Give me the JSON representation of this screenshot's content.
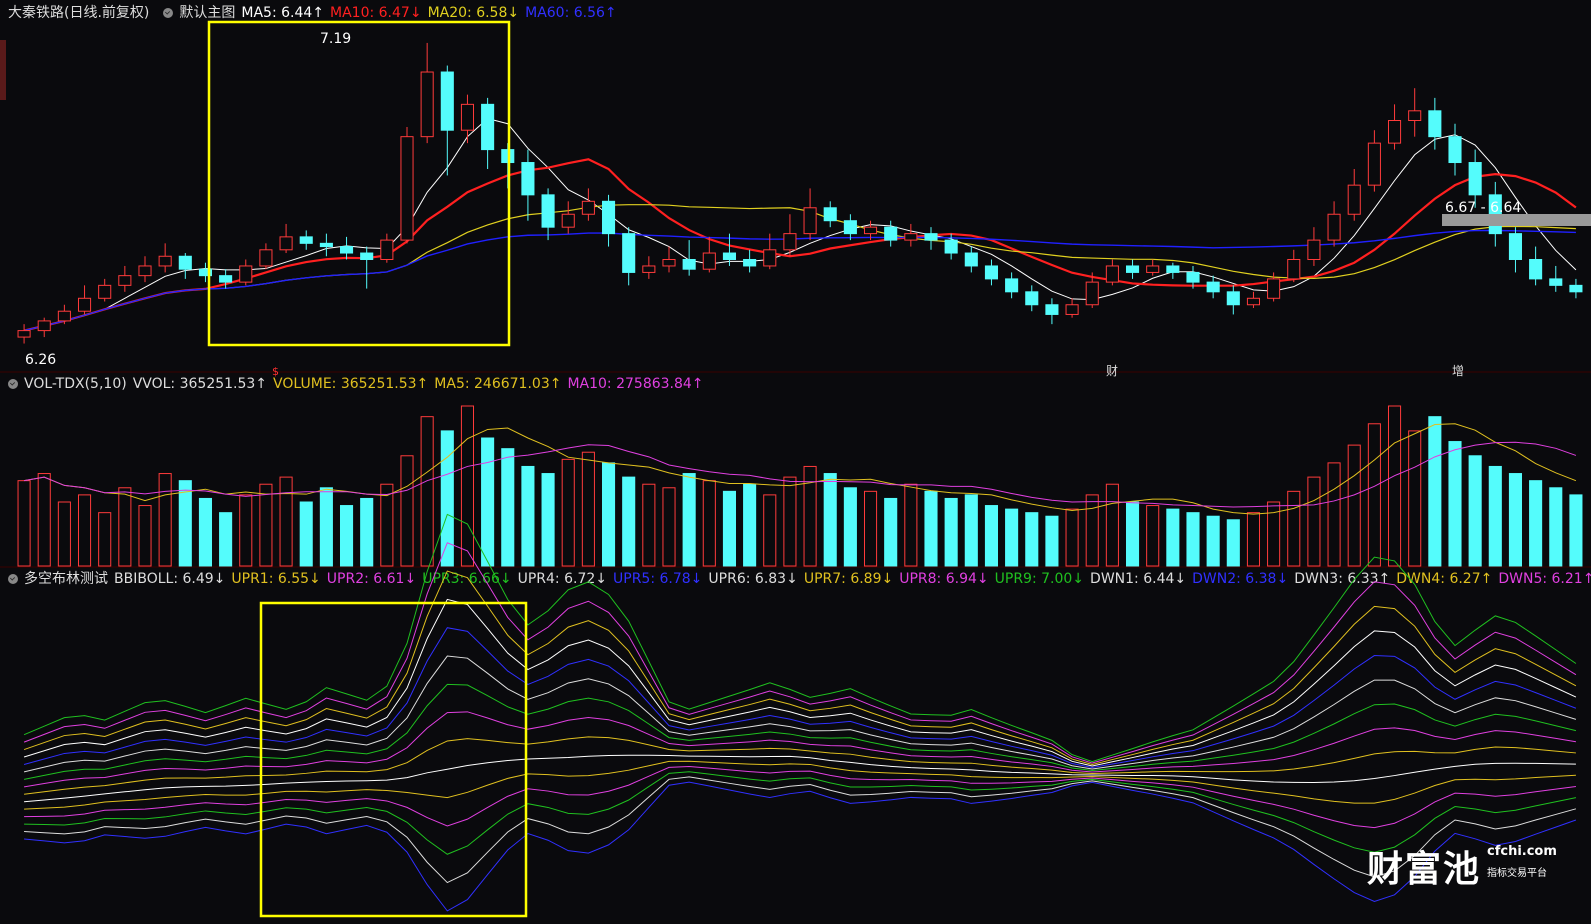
{
  "main_header": {
    "stock": "大秦铁路(日线.前复权)",
    "template": "默认主图",
    "ma5": "MA5: 6.44↑",
    "ma10": "MA10: 6.47↓",
    "ma20": "MA20: 6.58↓",
    "ma60": "MA60: 6.56↑"
  },
  "vol_header": {
    "name": "VOL-TDX(5,10)",
    "vvol": "VVOL: 365251.53↑",
    "volume": "VOLUME: 365251.53↑",
    "ma5": "MA5: 246671.03↑",
    "ma10": "MA10: 275863.84↑"
  },
  "boll_header": {
    "name": "多空布林测试",
    "bbiboll": "BBIBOLL: 6.49↓",
    "upr1": "UPR1: 6.55↓",
    "upr2": "UPR2: 6.61↓",
    "upr3": "UPR3: 6.66↓",
    "upr4": "UPR4: 6.72↓",
    "upr5": "UPR5: 6.78↓",
    "upr6": "UPR6: 6.83↓",
    "upr7": "UPR7: 6.89↓",
    "upr8": "UPR8: 6.94↓",
    "upr9": "UPR9: 7.00↓",
    "dwn1": "DWN1: 6.44↓",
    "dwn2": "DWN2: 6.38↓",
    "dwn3": "DWN3: 6.33↑",
    "dwn4": "DWN4: 6.27↑",
    "dwn5": "DWN5: 6.21↑"
  },
  "annotations": {
    "high_label": "7.19",
    "low_label": "6.26",
    "cursor_label": "6.67 - 6.64",
    "marker_s": "$",
    "marker_cai": "财",
    "marker_zeng": "增"
  },
  "watermark": {
    "brand": "财富池",
    "site": "cfchi.com",
    "tagline": "指标交易平台"
  },
  "colors": {
    "up": "#ff3b3b",
    "down": "#54fcfc",
    "ma5": "#ffffff",
    "ma10": "#ff2020",
    "ma20": "#e0d020",
    "ma60": "#2020ff",
    "highlight_box": "#ffff00"
  },
  "chart_data": [
    {
      "type": "candlestick",
      "title": "大秦铁路(日线.前复权)",
      "ylim": [
        6.26,
        7.19
      ],
      "candles": [
        [
          6.28,
          6.3,
          6.26,
          6.32
        ],
        [
          6.3,
          6.33,
          6.28,
          6.34
        ],
        [
          6.33,
          6.36,
          6.32,
          6.38
        ],
        [
          6.36,
          6.4,
          6.35,
          6.44
        ],
        [
          6.4,
          6.44,
          6.39,
          6.46
        ],
        [
          6.44,
          6.47,
          6.42,
          6.5
        ],
        [
          6.47,
          6.5,
          6.45,
          6.53
        ],
        [
          6.5,
          6.53,
          6.48,
          6.57
        ],
        [
          6.53,
          6.49,
          6.46,
          6.54
        ],
        [
          6.49,
          6.47,
          6.45,
          6.51
        ],
        [
          6.47,
          6.45,
          6.43,
          6.49
        ],
        [
          6.45,
          6.5,
          6.44,
          6.52
        ],
        [
          6.5,
          6.55,
          6.49,
          6.57
        ],
        [
          6.55,
          6.59,
          6.54,
          6.63
        ],
        [
          6.59,
          6.57,
          6.55,
          6.61
        ],
        [
          6.57,
          6.56,
          6.53,
          6.6
        ],
        [
          6.56,
          6.54,
          6.52,
          6.59
        ],
        [
          6.54,
          6.52,
          6.43,
          6.56
        ],
        [
          6.52,
          6.58,
          6.51,
          6.6
        ],
        [
          6.58,
          6.9,
          6.57,
          6.93
        ],
        [
          6.9,
          7.1,
          6.88,
          7.19
        ],
        [
          7.1,
          6.92,
          6.78,
          7.12
        ],
        [
          6.92,
          7.0,
          6.88,
          7.03
        ],
        [
          7.0,
          6.86,
          6.8,
          7.02
        ],
        [
          6.86,
          6.82,
          6.74,
          6.88
        ],
        [
          6.82,
          6.72,
          6.64,
          6.86
        ],
        [
          6.72,
          6.62,
          6.58,
          6.74
        ],
        [
          6.62,
          6.66,
          6.6,
          6.7
        ],
        [
          6.66,
          6.7,
          6.64,
          6.74
        ],
        [
          6.7,
          6.6,
          6.56,
          6.72
        ],
        [
          6.6,
          6.48,
          6.44,
          6.62
        ],
        [
          6.48,
          6.5,
          6.46,
          6.53
        ],
        [
          6.5,
          6.52,
          6.48,
          6.56
        ],
        [
          6.52,
          6.49,
          6.47,
          6.58
        ],
        [
          6.49,
          6.54,
          6.48,
          6.59
        ],
        [
          6.54,
          6.52,
          6.5,
          6.6
        ],
        [
          6.52,
          6.5,
          6.48,
          6.55
        ],
        [
          6.5,
          6.55,
          6.49,
          6.6
        ],
        [
          6.55,
          6.6,
          6.53,
          6.66
        ],
        [
          6.6,
          6.68,
          6.58,
          6.74
        ],
        [
          6.68,
          6.64,
          6.62,
          6.7
        ],
        [
          6.64,
          6.6,
          6.58,
          6.66
        ],
        [
          6.6,
          6.62,
          6.58,
          6.64
        ],
        [
          6.62,
          6.58,
          6.56,
          6.64
        ],
        [
          6.58,
          6.6,
          6.56,
          6.63
        ],
        [
          6.6,
          6.58,
          6.55,
          6.62
        ],
        [
          6.58,
          6.54,
          6.52,
          6.6
        ],
        [
          6.54,
          6.5,
          6.48,
          6.56
        ],
        [
          6.5,
          6.46,
          6.44,
          6.52
        ],
        [
          6.46,
          6.42,
          6.4,
          6.48
        ],
        [
          6.42,
          6.38,
          6.36,
          6.44
        ],
        [
          6.38,
          6.35,
          6.32,
          6.4
        ],
        [
          6.35,
          6.38,
          6.34,
          6.4
        ],
        [
          6.38,
          6.45,
          6.37,
          6.48
        ],
        [
          6.45,
          6.5,
          6.44,
          6.52
        ],
        [
          6.5,
          6.48,
          6.46,
          6.52
        ],
        [
          6.48,
          6.5,
          6.47,
          6.52
        ],
        [
          6.5,
          6.48,
          6.46,
          6.51
        ],
        [
          6.48,
          6.45,
          6.43,
          6.5
        ],
        [
          6.45,
          6.42,
          6.4,
          6.47
        ],
        [
          6.42,
          6.38,
          6.35,
          6.44
        ],
        [
          6.38,
          6.4,
          6.37,
          6.42
        ],
        [
          6.4,
          6.46,
          6.39,
          6.48
        ],
        [
          6.46,
          6.52,
          6.45,
          6.55
        ],
        [
          6.52,
          6.58,
          6.5,
          6.62
        ],
        [
          6.58,
          6.66,
          6.56,
          6.7
        ],
        [
          6.66,
          6.75,
          6.64,
          6.8
        ],
        [
          6.75,
          6.88,
          6.73,
          6.92
        ],
        [
          6.88,
          6.95,
          6.86,
          7.0
        ],
        [
          6.95,
          6.98,
          6.9,
          7.05
        ],
        [
          6.98,
          6.9,
          6.86,
          7.02
        ],
        [
          6.9,
          6.82,
          6.78,
          6.94
        ],
        [
          6.82,
          6.72,
          6.68,
          6.86
        ],
        [
          6.72,
          6.6,
          6.56,
          6.76
        ],
        [
          6.6,
          6.52,
          6.48,
          6.62
        ],
        [
          6.52,
          6.46,
          6.44,
          6.56
        ],
        [
          6.46,
          6.44,
          6.42,
          6.5
        ],
        [
          6.44,
          6.42,
          6.4,
          6.46
        ]
      ],
      "high_marker": 7.19,
      "low_marker": 6.26,
      "series": [
        {
          "name": "MA5",
          "last": 6.44
        },
        {
          "name": "MA10",
          "last": 6.47
        },
        {
          "name": "MA20",
          "last": 6.58
        },
        {
          "name": "MA60",
          "last": 6.56
        }
      ]
    },
    {
      "type": "bar",
      "title": "VOL-TDX(5,10)",
      "values": [
        240,
        260,
        180,
        200,
        150,
        220,
        170,
        260,
        240,
        190,
        150,
        200,
        230,
        250,
        180,
        220,
        170,
        190,
        230,
        310,
        420,
        380,
        450,
        360,
        330,
        280,
        260,
        300,
        320,
        290,
        250,
        230,
        220,
        260,
        240,
        210,
        230,
        200,
        250,
        280,
        260,
        220,
        210,
        190,
        230,
        210,
        190,
        200,
        170,
        160,
        150,
        140,
        160,
        200,
        230,
        180,
        170,
        160,
        150,
        140,
        130,
        150,
        180,
        210,
        250,
        290,
        340,
        400,
        450,
        380,
        420,
        350,
        310,
        280,
        260,
        240,
        220,
        200
      ],
      "series": [
        {
          "name": "VOLUME",
          "last": 365251.53
        },
        {
          "name": "MA5",
          "last": 246671.03
        },
        {
          "name": "MA10",
          "last": 275863.84
        }
      ]
    },
    {
      "type": "line",
      "title": "多空布林测试",
      "series": [
        {
          "name": "BBIBOLL",
          "last": 6.49
        },
        {
          "name": "UPR1",
          "last": 6.55
        },
        {
          "name": "UPR2",
          "last": 6.61
        },
        {
          "name": "UPR3",
          "last": 6.66
        },
        {
          "name": "UPR4",
          "last": 6.72
        },
        {
          "name": "UPR5",
          "last": 6.78
        },
        {
          "name": "UPR6",
          "last": 6.83
        },
        {
          "name": "UPR7",
          "last": 6.89
        },
        {
          "name": "UPR8",
          "last": 6.94
        },
        {
          "name": "UPR9",
          "last": 7.0
        },
        {
          "name": "DWN1",
          "last": 6.44
        },
        {
          "name": "DWN2",
          "last": 6.38
        },
        {
          "name": "DWN3",
          "last": 6.33
        },
        {
          "name": "DWN4",
          "last": 6.27
        },
        {
          "name": "DWN5",
          "last": 6.21
        }
      ],
      "band_width": [
        0.1,
        0.11,
        0.12,
        0.12,
        0.11,
        0.12,
        0.13,
        0.13,
        0.12,
        0.11,
        0.12,
        0.13,
        0.12,
        0.11,
        0.12,
        0.14,
        0.13,
        0.12,
        0.14,
        0.2,
        0.3,
        0.38,
        0.36,
        0.3,
        0.24,
        0.2,
        0.22,
        0.25,
        0.26,
        0.24,
        0.2,
        0.14,
        0.08,
        0.07,
        0.08,
        0.09,
        0.1,
        0.11,
        0.1,
        0.09,
        0.1,
        0.11,
        0.1,
        0.09,
        0.08,
        0.08,
        0.08,
        0.09,
        0.08,
        0.07,
        0.06,
        0.05,
        0.03,
        0.02,
        0.03,
        0.04,
        0.05,
        0.06,
        0.07,
        0.09,
        0.11,
        0.13,
        0.15,
        0.18,
        0.22,
        0.26,
        0.3,
        0.33,
        0.32,
        0.28,
        0.22,
        0.18,
        0.2,
        0.22,
        0.21,
        0.19,
        0.17,
        0.15
      ]
    }
  ]
}
